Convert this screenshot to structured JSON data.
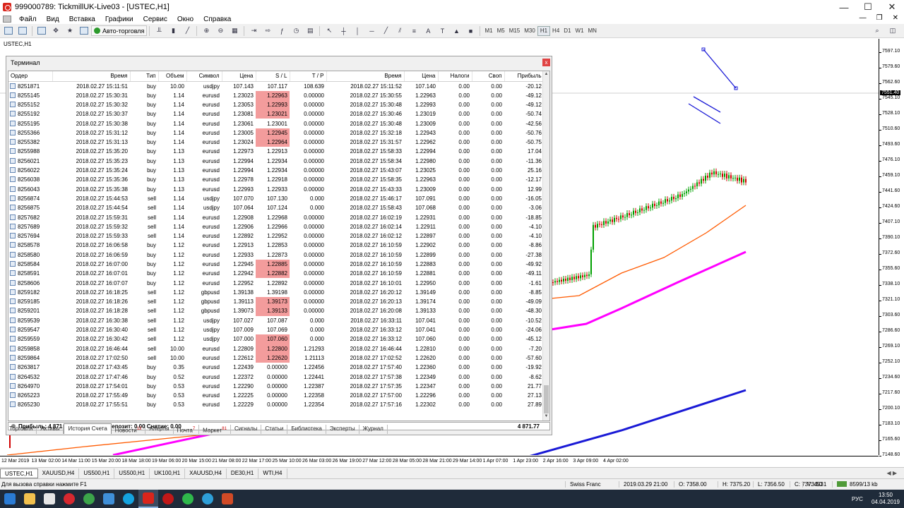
{
  "window": {
    "title": "999000789: TickmillUK-Live03 - [USTEC,H1]",
    "controls": {
      "minimize": "—",
      "maximize": "☐",
      "close": "✕"
    }
  },
  "menu": {
    "items": [
      "Файл",
      "Вид",
      "Вставка",
      "Графики",
      "Сервис",
      "Окно",
      "Справка"
    ],
    "right": {
      "minimize": "—",
      "restore": "❐",
      "close": "✕"
    }
  },
  "toolbar": {
    "autotrade_label": "Авто-торговля",
    "timeframes": [
      "M1",
      "M5",
      "M15",
      "M30",
      "H1",
      "H4",
      "D1",
      "W1",
      "MN"
    ],
    "active_timeframe": "H1"
  },
  "chart": {
    "caption": "USTEC,H1",
    "current_price": "7551.40",
    "price_labels": [
      "7597.10",
      "7579.60",
      "7562.60",
      "7545.10",
      "7528.10",
      "7510.60",
      "7493.60",
      "7476.10",
      "7459.10",
      "7441.60",
      "7424.60",
      "7407.10",
      "7390.10",
      "7372.60",
      "7355.60",
      "7338.10",
      "7321.10",
      "7303.60",
      "7286.60",
      "7269.10",
      "7252.10",
      "7234.60",
      "7217.60",
      "7200.10",
      "7183.10",
      "7165.60",
      "7148.60"
    ],
    "time_labels": [
      "12 Mar 2019",
      "13 Mar 02:00",
      "14 Mar 11:00",
      "15 Mar 20:00",
      "18 Mar 18:00",
      "19 Mar 06:00",
      "20 Mar 15:00",
      "21 Mar 08:00",
      "22 Mar 17:00",
      "25 Mar 10:00",
      "26 Mar 03:00",
      "26 Mar 19:00",
      "27 Mar 12:00",
      "28 Mar 05:00",
      "28 Mar 21:00",
      "29 Mar 14:00",
      "1 Apr 07:00",
      "1 Apr 23:00",
      "2 Apr 16:00",
      "3 Apr 09:00",
      "4 Apr 02:00"
    ],
    "colors": {
      "ma_fast": "#ff5a00",
      "ma_mid": "#ff00ff",
      "ma_slow": "#1a1ad6",
      "trend": "#1a1ad6",
      "bull": "#00a000",
      "bear": "#d00000"
    }
  },
  "terminal": {
    "title": "Терминал",
    "close_label": "x",
    "columns": [
      "Ордер",
      "Время",
      "Тип",
      "Объем",
      "Символ",
      "Цена",
      "S / L",
      "T / P",
      "Время",
      "Цена",
      "Налоги",
      "Своп",
      "Прибыль"
    ],
    "rows": [
      [
        "8251871",
        "2018.02.27 15:11:51",
        "buy",
        "10.00",
        "usdjpy",
        "107.143",
        "107.117",
        "108.639",
        "2018.02.27 15:11:52",
        "107.140",
        "0.00",
        "0.00",
        "-20.12"
      ],
      [
        "8255145",
        "2018.02.27 15:30:31",
        "buy",
        "1.14",
        "eurusd",
        "1.23023",
        "1.22963",
        "0.00000",
        "2018.02.27 15:30:55",
        "1.22963",
        "0.00",
        "0.00",
        "-49.12"
      ],
      [
        "8255152",
        "2018.02.27 15:30:32",
        "buy",
        "1.14",
        "eurusd",
        "1.23053",
        "1.22993",
        "0.00000",
        "2018.02.27 15:30:48",
        "1.22993",
        "0.00",
        "0.00",
        "-49.12"
      ],
      [
        "8255192",
        "2018.02.27 15:30:37",
        "buy",
        "1.14",
        "eurusd",
        "1.23081",
        "1.23021",
        "0.00000",
        "2018.02.27 15:30:46",
        "1.23019",
        "0.00",
        "0.00",
        "-50.74"
      ],
      [
        "8255195",
        "2018.02.27 15:30:38",
        "buy",
        "1.14",
        "eurusd",
        "1.23061",
        "1.23001",
        "0.00000",
        "2018.02.27 15:30:48",
        "1.23009",
        "0.00",
        "0.00",
        "-42.56"
      ],
      [
        "8255366",
        "2018.02.27 15:31:12",
        "buy",
        "1.14",
        "eurusd",
        "1.23005",
        "1.22945",
        "0.00000",
        "2018.02.27 15:32:18",
        "1.22943",
        "0.00",
        "0.00",
        "-50.76"
      ],
      [
        "8255382",
        "2018.02.27 15:31:13",
        "buy",
        "1.14",
        "eurusd",
        "1.23024",
        "1.22964",
        "0.00000",
        "2018.02.27 15:31:57",
        "1.22962",
        "0.00",
        "0.00",
        "-50.75"
      ],
      [
        "8255988",
        "2018.02.27 15:35:20",
        "buy",
        "1.13",
        "eurusd",
        "1.22973",
        "1.22913",
        "0.00000",
        "2018.02.27 15:58:33",
        "1.22994",
        "0.00",
        "0.00",
        "17.04"
      ],
      [
        "8256021",
        "2018.02.27 15:35:23",
        "buy",
        "1.13",
        "eurusd",
        "1.22994",
        "1.22934",
        "0.00000",
        "2018.02.27 15:58:34",
        "1.22980",
        "0.00",
        "0.00",
        "-11.36"
      ],
      [
        "8256022",
        "2018.02.27 15:35:24",
        "buy",
        "1.13",
        "eurusd",
        "1.22994",
        "1.22934",
        "0.00000",
        "2018.02.27 15:43:07",
        "1.23025",
        "0.00",
        "0.00",
        "25.16"
      ],
      [
        "8256038",
        "2018.02.27 15:35:36",
        "buy",
        "1.13",
        "eurusd",
        "1.22978",
        "1.22918",
        "0.00000",
        "2018.02.27 15:58:35",
        "1.22963",
        "0.00",
        "0.00",
        "-12.17"
      ],
      [
        "8256043",
        "2018.02.27 15:35:38",
        "buy",
        "1.13",
        "eurusd",
        "1.22993",
        "1.22933",
        "0.00000",
        "2018.02.27 15:43:33",
        "1.23009",
        "0.00",
        "0.00",
        "12.99"
      ],
      [
        "8256874",
        "2018.02.27 15:44:53",
        "sell",
        "1.14",
        "usdjpy",
        "107.070",
        "107.130",
        "0.000",
        "2018.02.27 15:46:17",
        "107.091",
        "0.00",
        "0.00",
        "-16.05"
      ],
      [
        "8256875",
        "2018.02.27 15:44:54",
        "sell",
        "1.14",
        "usdjpy",
        "107.064",
        "107.124",
        "0.000",
        "2018.02.27 15:58:43",
        "107.068",
        "0.00",
        "0.00",
        "-3.06"
      ],
      [
        "8257682",
        "2018.02.27 15:59:31",
        "sell",
        "1.14",
        "eurusd",
        "1.22908",
        "1.22968",
        "0.00000",
        "2018.02.27 16:02:19",
        "1.22931",
        "0.00",
        "0.00",
        "-18.85"
      ],
      [
        "8257689",
        "2018.02.27 15:59:32",
        "sell",
        "1.14",
        "eurusd",
        "1.22906",
        "1.22966",
        "0.00000",
        "2018.02.27 16:02:14",
        "1.22911",
        "0.00",
        "0.00",
        "-4.10"
      ],
      [
        "8257694",
        "2018.02.27 15:59:33",
        "sell",
        "1.14",
        "eurusd",
        "1.22892",
        "1.22952",
        "0.00000",
        "2018.02.27 16:02:12",
        "1.22897",
        "0.00",
        "0.00",
        "-4.10"
      ],
      [
        "8258578",
        "2018.02.27 16:06:58",
        "buy",
        "1.12",
        "eurusd",
        "1.22913",
        "1.22853",
        "0.00000",
        "2018.02.27 16:10:59",
        "1.22902",
        "0.00",
        "0.00",
        "-8.86"
      ],
      [
        "8258580",
        "2018.02.27 16:06:59",
        "buy",
        "1.12",
        "eurusd",
        "1.22933",
        "1.22873",
        "0.00000",
        "2018.02.27 16:10:59",
        "1.22899",
        "0.00",
        "0.00",
        "-27.38"
      ],
      [
        "8258584",
        "2018.02.27 16:07:00",
        "buy",
        "1.12",
        "eurusd",
        "1.22945",
        "1.22885",
        "0.00000",
        "2018.02.27 16:10:59",
        "1.22883",
        "0.00",
        "0.00",
        "-49.92"
      ],
      [
        "8258591",
        "2018.02.27 16:07:01",
        "buy",
        "1.12",
        "eurusd",
        "1.22942",
        "1.22882",
        "0.00000",
        "2018.02.27 16:10:59",
        "1.22881",
        "0.00",
        "0.00",
        "-49.11"
      ],
      [
        "8258606",
        "2018.02.27 16:07:07",
        "buy",
        "1.12",
        "eurusd",
        "1.22952",
        "1.22892",
        "0.00000",
        "2018.02.27 16:10:01",
        "1.22950",
        "0.00",
        "0.00",
        "-1.61"
      ],
      [
        "8259182",
        "2018.02.27 16:18:25",
        "sell",
        "1.12",
        "gbpusd",
        "1.39138",
        "1.39198",
        "0.00000",
        "2018.02.27 16:20:12",
        "1.39149",
        "0.00",
        "0.00",
        "-8.85"
      ],
      [
        "8259185",
        "2018.02.27 16:18:26",
        "sell",
        "1.12",
        "gbpusd",
        "1.39113",
        "1.39173",
        "0.00000",
        "2018.02.27 16:20:13",
        "1.39174",
        "0.00",
        "0.00",
        "-49.09"
      ],
      [
        "8259201",
        "2018.02.27 16:18:28",
        "sell",
        "1.12",
        "gbpusd",
        "1.39073",
        "1.39133",
        "0.00000",
        "2018.02.27 16:20:08",
        "1.39133",
        "0.00",
        "0.00",
        "-48.30"
      ],
      [
        "8259539",
        "2018.02.27 16:30:38",
        "sell",
        "1.12",
        "usdjpy",
        "107.027",
        "107.087",
        "0.000",
        "2018.02.27 16:33:11",
        "107.041",
        "0.00",
        "0.00",
        "-10.52"
      ],
      [
        "8259547",
        "2018.02.27 16:30:40",
        "sell",
        "1.12",
        "usdjpy",
        "107.009",
        "107.069",
        "0.000",
        "2018.02.27 16:33:12",
        "107.041",
        "0.00",
        "0.00",
        "-24.06"
      ],
      [
        "8259559",
        "2018.02.27 16:30:42",
        "sell",
        "1.12",
        "usdjpy",
        "107.000",
        "107.060",
        "0.000",
        "2018.02.27 16:33:12",
        "107.060",
        "0.00",
        "0.00",
        "-45.12"
      ],
      [
        "8259858",
        "2018.02.27 16:46:44",
        "sell",
        "10.00",
        "eurusd",
        "1.22809",
        "1.22800",
        "1.21293",
        "2018.02.27 16:46:44",
        "1.22810",
        "0.00",
        "0.00",
        "-7.20"
      ],
      [
        "8259864",
        "2018.02.27 17:02:50",
        "sell",
        "10.00",
        "eurusd",
        "1.22612",
        "1.22620",
        "1.21113",
        "2018.02.27 17:02:52",
        "1.22620",
        "0.00",
        "0.00",
        "-57.60"
      ],
      [
        "8263817",
        "2018.02.27 17:43:45",
        "buy",
        "0.35",
        "eurusd",
        "1.22439",
        "0.00000",
        "1.22456",
        "2018.02.27 17:57:40",
        "1.22360",
        "0.00",
        "0.00",
        "-19.92"
      ],
      [
        "8264532",
        "2018.02.27 17:47:46",
        "buy",
        "0.52",
        "eurusd",
        "1.22372",
        "0.00000",
        "1.22441",
        "2018.02.27 17:57:38",
        "1.22349",
        "0.00",
        "0.00",
        "-8.62"
      ],
      [
        "8264970",
        "2018.02.27 17:54:01",
        "buy",
        "0.53",
        "eurusd",
        "1.22290",
        "0.00000",
        "1.22387",
        "2018.02.27 17:57:35",
        "1.22347",
        "0.00",
        "0.00",
        "21.77"
      ],
      [
        "8265223",
        "2018.02.27 17:55:49",
        "buy",
        "0.53",
        "eurusd",
        "1.22225",
        "0.00000",
        "1.22358",
        "2018.02.27 17:57:00",
        "1.22296",
        "0.00",
        "0.00",
        "27.13"
      ],
      [
        "8265230",
        "2018.02.27 17:55:51",
        "buy",
        "0.53",
        "eurusd",
        "1.22229",
        "0.00000",
        "1.22354",
        "2018.02.27 17:57:16",
        "1.22302",
        "0.00",
        "0.00",
        "27.89"
      ]
    ],
    "highlight_sl_rows": [
      1,
      2,
      3,
      5,
      6,
      19,
      20,
      23,
      24,
      27,
      28,
      29
    ],
    "highlight_color": "#f39c9c",
    "summary": {
      "text": "Прибыль: 4 871.77  Кредит: 0.00  Депозит: 0.00  Снятие: 0.00",
      "total": "4 871.77"
    },
    "tabs": [
      {
        "label": "Торговля",
        "badge": ""
      },
      {
        "label": "Активы",
        "badge": ""
      },
      {
        "label": "История Счета",
        "badge": ""
      },
      {
        "label": "Новости",
        "badge": "12"
      },
      {
        "label": "Алерты",
        "badge": ""
      },
      {
        "label": "Почта",
        "badge": "7"
      },
      {
        "label": "Маркет",
        "badge": "81"
      },
      {
        "label": "Сигналы",
        "badge": ""
      },
      {
        "label": "Статьи",
        "badge": ""
      },
      {
        "label": "Библиотека",
        "badge": ""
      },
      {
        "label": "Эксперты",
        "badge": ""
      },
      {
        "label": "Журнал",
        "badge": ""
      }
    ],
    "active_tab": "История Счета"
  },
  "chart_tabs": {
    "items": [
      "USTEC,H1",
      "XAUUSD,H4",
      "US500,H1",
      "US500,H1",
      "UK100,H1",
      "XAUUSD,H4",
      "DE30,H1",
      "WTI,H4"
    ],
    "active": "USTEC,H1"
  },
  "status": {
    "help": "Для вызова справки нажмите F1",
    "profile": "Swiss Franc",
    "datetime": "2019.03.29 21:00",
    "open": "O: 7358.00",
    "high": "H: 7375.20",
    "low": "L: 7356.50",
    "close": "C: 7373.50",
    "volume": "V: 4531",
    "traffic": "8599/13 kb"
  },
  "taskbar": {
    "lang": "РУС",
    "time": "13:50",
    "date": "04.04.2019"
  }
}
